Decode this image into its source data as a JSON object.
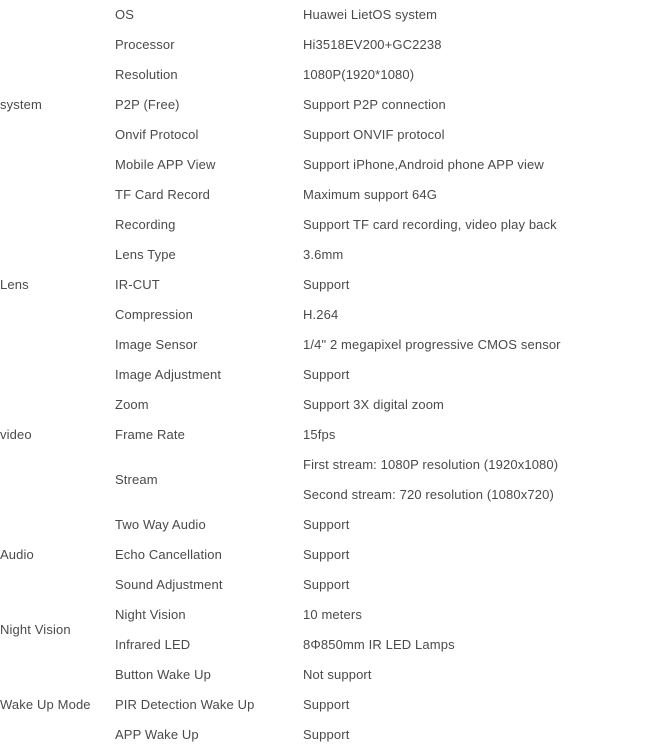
{
  "document": {
    "type": "product-specification-table",
    "background_color": "#ffffff",
    "text_color": "#4a4a4a",
    "columns": 3
  },
  "groups": [
    {
      "category": "system",
      "rows": [
        {
          "name": "OS",
          "value": "Huawei LietOS system"
        },
        {
          "name": "Processor",
          "value": "Hi3518EV200+GC2238"
        },
        {
          "name": "Resolution",
          "value": "1080P(1920*1080)"
        },
        {
          "name": "P2P (Free)",
          "value": "Support P2P connection"
        },
        {
          "name": "Onvif Protocol",
          "value": "Support ONVIF protocol"
        },
        {
          "name": "Mobile APP View",
          "value": "Support iPhone,Android phone APP view"
        },
        {
          "name": "TF Card Record",
          "value": "Maximum support 64G"
        }
      ]
    },
    {
      "category": "Lens",
      "rows": [
        {
          "name": "Recording",
          "value": "Support TF card recording, video play back"
        },
        {
          "name": "Lens Type",
          "value": "3.6mm"
        },
        {
          "name": "IR-CUT",
          "value": "Support"
        },
        {
          "name": "Compression",
          "value": "H.264"
        },
        {
          "name": "Image Sensor",
          "value": "1/4\" 2 megapixel progressive CMOS sensor"
        }
      ]
    },
    {
      "category": "video",
      "rows": [
        {
          "name": "Image Adjustment",
          "value": "Support"
        },
        {
          "name": "Zoom",
          "value": "Support 3X digital zoom"
        },
        {
          "name": "Frame Rate",
          "value": "15fps"
        },
        {
          "name": "Stream",
          "value_lines": [
            "First stream: 1080P resolution (1920x1080)",
            "Second stream: 720 resolution (1080x720)"
          ]
        }
      ]
    },
    {
      "category": "Audio",
      "rows": [
        {
          "name": "Two Way Audio",
          "value": "Support"
        },
        {
          "name": "Echo Cancellation",
          "value": "Support"
        },
        {
          "name": "Sound Adjustment",
          "value": "Support"
        }
      ]
    },
    {
      "category": "Night Vision",
      "rows": [
        {
          "name": "Night Vision",
          "value": "10 meters"
        },
        {
          "name": "Infrared LED",
          "value": "8Φ850mm IR LED Lamps"
        }
      ]
    },
    {
      "category": "Wake Up Mode",
      "rows": [
        {
          "name": "Button Wake Up",
          "value": "Not support"
        },
        {
          "name": "PIR Detection Wake Up",
          "value": "Support"
        },
        {
          "name": "APP Wake Up",
          "value": "Support"
        }
      ]
    }
  ]
}
